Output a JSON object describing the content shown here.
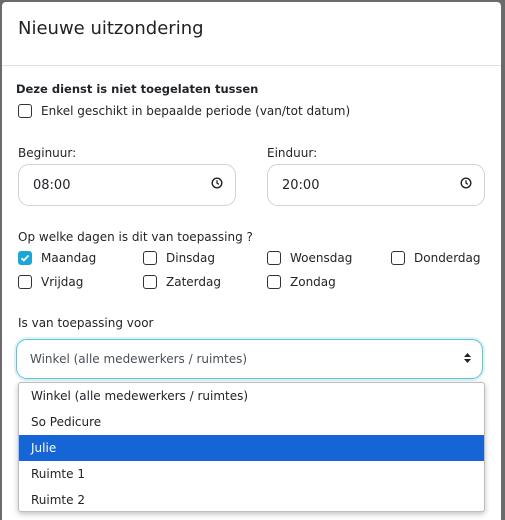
{
  "modal": {
    "title": "Nieuwe uitzondering"
  },
  "section_title": "Deze dienst is niet toegelaten tussen",
  "period_checkbox": {
    "label": "Enkel geschikt in bepaalde periode (van/tot datum)",
    "checked": false
  },
  "start": {
    "label": "Beginuur:",
    "value": "08:00"
  },
  "end": {
    "label": "Einduur:",
    "value": "20:00"
  },
  "days_label": "Op welke dagen is dit van toepassing ?",
  "days": [
    {
      "label": "Maandag",
      "checked": true
    },
    {
      "label": "Dinsdag",
      "checked": false
    },
    {
      "label": "Woensdag",
      "checked": false
    },
    {
      "label": "Donderdag",
      "checked": false
    },
    {
      "label": "Vrijdag",
      "checked": false
    },
    {
      "label": "Zaterdag",
      "checked": false
    },
    {
      "label": "Zondag",
      "checked": false
    }
  ],
  "applies_label": "Is van toepassing voor",
  "select": {
    "value": "Winkel (alle medewerkers / ruimtes)",
    "options": [
      "Winkel (alle medewerkers / ruimtes)",
      "So Pedicure",
      "Julie",
      "Ruimte 1",
      "Ruimte 2"
    ],
    "highlighted": "Julie"
  },
  "colors": {
    "accent": "#1aa6d6",
    "highlight": "#1565d6"
  },
  "icons": {
    "time": "clock-icon",
    "select": "sort-arrows-icon"
  }
}
